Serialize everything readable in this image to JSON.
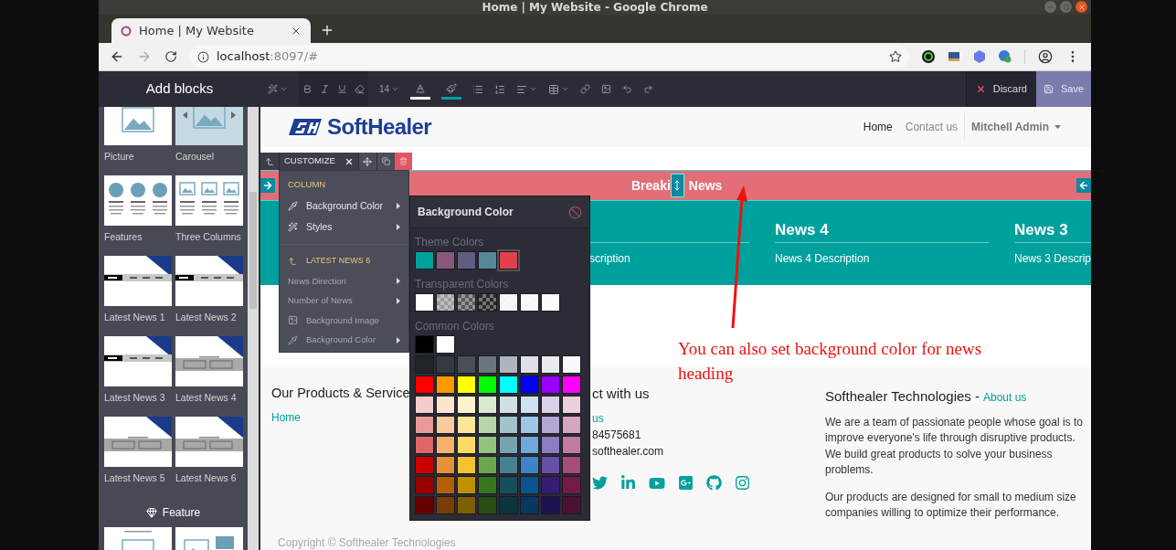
{
  "browser": {
    "window_title": "Home | My Website - Google Chrome",
    "tab": {
      "title": "Home | My Website",
      "selected": true
    },
    "address": {
      "host": "localhost",
      "rest": ":8097/#"
    }
  },
  "editor": {
    "sidebar_title": "Add blocks",
    "font_size": "14",
    "actions": [
      {
        "kind": "discard",
        "label": "Discard"
      },
      {
        "kind": "save",
        "label": "Save"
      }
    ]
  },
  "sidebar": {
    "blocks": [
      {
        "label": "Picture",
        "kind": "picture"
      },
      {
        "label": "Carousel",
        "kind": "carousel"
      },
      {
        "label": "Features",
        "kind": "features"
      },
      {
        "label": "Three Columns",
        "kind": "columns"
      },
      {
        "label": "Latest News 1",
        "kind": "ticker"
      },
      {
        "label": "Latest News 2",
        "kind": "ticker"
      },
      {
        "label": "Latest News 3",
        "kind": "ticker"
      },
      {
        "label": "Latest News 4",
        "kind": "cards"
      },
      {
        "label": "Latest News 5",
        "kind": "cards"
      },
      {
        "label": "Latest News 6",
        "kind": "cards"
      }
    ],
    "section_title": "Feature",
    "section_blocks": [
      {
        "kind": "picture"
      },
      {
        "kind": "layout"
      }
    ]
  },
  "site": {
    "logo": "SoftHealer",
    "nav": [
      {
        "label": "Home",
        "selected": true
      },
      {
        "label": "Contact us",
        "selected": false
      }
    ],
    "user": "Mitchell Admin"
  },
  "breaking_news": {
    "title_before_handle": "Breaki",
    "title_after_handle": "News",
    "items": [
      {
        "description": "scription"
      },
      {
        "title": "News 4",
        "description": "News 4 Description"
      },
      {
        "title": "News 3",
        "description": "News 3 Descrip"
      }
    ]
  },
  "customize": {
    "label": "CUSTOMIZE",
    "menu": [
      {
        "kind": "heading",
        "label": "COLUMN",
        "muted": false
      },
      {
        "kind": "color",
        "label": "Background Color",
        "submenu": true,
        "muted": false
      },
      {
        "kind": "style",
        "label": "Styles",
        "submenu": true,
        "muted": false
      },
      {
        "kind": "divider"
      },
      {
        "kind": "subheading",
        "label": "LATEST NEWS 6",
        "muted": false
      },
      {
        "kind": "plain",
        "label": "News Direction",
        "submenu": true,
        "muted": true
      },
      {
        "kind": "plain",
        "label": "Number of News",
        "submenu": true,
        "muted": true
      },
      {
        "kind": "image",
        "label": "Background Image",
        "submenu": false,
        "muted": true
      },
      {
        "kind": "color",
        "label": "Background Color",
        "submenu": true,
        "muted": true
      }
    ]
  },
  "color_picker": {
    "title": "Background Color",
    "theme": {
      "label": "Theme Colors",
      "swatches": [
        {
          "color": "#00a09d",
          "selected": false
        },
        {
          "color": "#875a7b",
          "selected": false
        },
        {
          "color": "#5f5e82",
          "selected": false
        },
        {
          "color": "#558899",
          "selected": false
        },
        {
          "color": "#e0404f",
          "selected": true
        }
      ]
    },
    "transparent": {
      "label": "Transparent Colors",
      "swatches": [
        {
          "color": "#ffffff"
        },
        {
          "color": "#9a9a9a"
        },
        {
          "color": "#5a5a5a"
        },
        {
          "color": "#2a2a2a"
        },
        {
          "color": "#f4f4f4"
        },
        {
          "color": "#f8f8f8"
        },
        {
          "color": "#fcfcfc"
        }
      ]
    },
    "common": {
      "label": "Common Colors",
      "basics": [
        {
          "color": "#000000"
        },
        {
          "color": "#ffffff"
        }
      ],
      "rows": [
        [
          {
            "color": "#212529"
          },
          {
            "color": "#343a40"
          },
          {
            "color": "#495057"
          },
          {
            "color": "#6c757d"
          },
          {
            "color": "#adb5bd"
          },
          {
            "color": "#dee2e6"
          },
          {
            "color": "#e9ecef"
          },
          {
            "color": "#f8f9fa"
          }
        ],
        [
          {
            "color": "#ff0000"
          },
          {
            "color": "#ff9900"
          },
          {
            "color": "#ffff00"
          },
          {
            "color": "#00ff00"
          },
          {
            "color": "#00ffff"
          },
          {
            "color": "#0000ff"
          },
          {
            "color": "#9900ff"
          },
          {
            "color": "#ff00ff"
          }
        ],
        [
          {
            "color": "#f4cccc"
          },
          {
            "color": "#fce5cd"
          },
          {
            "color": "#fff2cc"
          },
          {
            "color": "#d9ead3"
          },
          {
            "color": "#d0e0e3"
          },
          {
            "color": "#cfe2f3"
          },
          {
            "color": "#d9d2e9"
          },
          {
            "color": "#ead1dc"
          }
        ],
        [
          {
            "color": "#ea9999"
          },
          {
            "color": "#f9cb9c"
          },
          {
            "color": "#ffe599"
          },
          {
            "color": "#b6d7a8"
          },
          {
            "color": "#a2c4c9"
          },
          {
            "color": "#9fc5e8"
          },
          {
            "color": "#b4a7d6"
          },
          {
            "color": "#d5a6bd"
          }
        ],
        [
          {
            "color": "#e06666"
          },
          {
            "color": "#f6b26b"
          },
          {
            "color": "#ffd966"
          },
          {
            "color": "#93c47d"
          },
          {
            "color": "#76a5af"
          },
          {
            "color": "#6fa8dc"
          },
          {
            "color": "#8e7cc3"
          },
          {
            "color": "#c27ba0"
          }
        ],
        [
          {
            "color": "#cc0000"
          },
          {
            "color": "#e69138"
          },
          {
            "color": "#f1c232"
          },
          {
            "color": "#6aa84f"
          },
          {
            "color": "#45818e"
          },
          {
            "color": "#3d85c6"
          },
          {
            "color": "#674ea7"
          },
          {
            "color": "#a64d79"
          }
        ],
        [
          {
            "color": "#990000"
          },
          {
            "color": "#b45f06"
          },
          {
            "color": "#bf9000"
          },
          {
            "color": "#38761d"
          },
          {
            "color": "#134f5c"
          },
          {
            "color": "#0b5394"
          },
          {
            "color": "#351c75"
          },
          {
            "color": "#741b47"
          }
        ],
        [
          {
            "color": "#660000"
          },
          {
            "color": "#783f04"
          },
          {
            "color": "#7f6000"
          },
          {
            "color": "#274e13"
          },
          {
            "color": "#0c343d"
          },
          {
            "color": "#073763"
          },
          {
            "color": "#20124d"
          },
          {
            "color": "#4c1130"
          }
        ]
      ]
    }
  },
  "annotation": {
    "text": "You can also set background color for news heading"
  },
  "footer": {
    "products": {
      "title": "Our Products & Service",
      "links": [
        "Home"
      ]
    },
    "contact": {
      "title": "ct with us",
      "lines": [
        {
          "kind": "link",
          "text": "us"
        },
        {
          "kind": "text",
          "text": "84575681"
        },
        {
          "kind": "text",
          "text": "softhealer.com"
        }
      ]
    },
    "about": {
      "title": "Softhealer Technologies -",
      "link": "About us",
      "paragraphs": [
        "We are a team of passionate people whose goal is to improve everyone's life through disruptive products. We build great products to solve your business problems.",
        "Our products are designed for small to medium size companies willing to optimize their performance."
      ]
    },
    "copyright": "Copyright © Softhealer Technologies"
  }
}
